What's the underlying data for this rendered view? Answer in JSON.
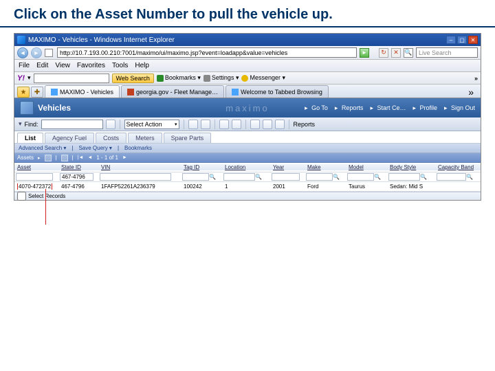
{
  "slide": {
    "title": "Click on the Asset Number to pull the vehicle up."
  },
  "ie": {
    "title": "MAXIMO - Vehicles - Windows Internet Explorer",
    "url": "http://10.7.193.00.210:7001/maximo/ui/maximo.jsp?event=loadapp&value=vehicles",
    "search_placeholder": "Live Search",
    "menus": [
      "File",
      "Edit",
      "View",
      "Favorites",
      "Tools",
      "Help"
    ],
    "yahoo": {
      "brand": "Y!",
      "search_btn": "Web Search",
      "links": [
        {
          "label": "Bookmarks ▾",
          "color": "#2a8a2a"
        },
        {
          "label": "Settings ▾",
          "color": "#888"
        },
        {
          "label": "Messenger ▾",
          "color": "#e6b800"
        }
      ],
      "more": "»"
    },
    "tabs": [
      {
        "label": "MAXIMO - Vehicles",
        "active": true,
        "icon": "#4aa3ff"
      },
      {
        "label": "georgia.gov - Fleet Manage…",
        "active": false,
        "icon": "#c04020"
      },
      {
        "label": "Welcome to Tabbed Browsing",
        "active": false,
        "icon": "#4aa3ff"
      }
    ],
    "chevron": "»"
  },
  "maximo": {
    "logo": "maximo",
    "module": "Vehicles",
    "nav": [
      {
        "label": "Go To",
        "icon": "#e0e0e0"
      },
      {
        "label": "Reports",
        "icon": "#e0e0e0"
      },
      {
        "label": "Start Ce…",
        "icon": "#e0e0e0"
      },
      {
        "label": "Profile",
        "icon": "#e0e0e0"
      },
      {
        "label": "Sign Out",
        "icon": "#e0e0e0"
      }
    ],
    "find_label": "Find:",
    "action_select": "Select Action",
    "reports_btn": "Reports",
    "subtabs": [
      "List",
      "Agency Fuel",
      "Costs",
      "Meters",
      "Spare Parts"
    ],
    "active_subtab": 0,
    "advlinks": [
      "Advanced Search ▾",
      "Save Query ▾",
      "Bookmarks"
    ],
    "assets_bar": {
      "title": "Assets",
      "pager": "1 - 1 of 1"
    },
    "columns": [
      "Asset",
      "State ID",
      "VIN",
      "Tag ID",
      "Location",
      "Year",
      "Make",
      "Model",
      "Body Style",
      "Capacity Band"
    ],
    "filters": {
      "state_id": "467-4796"
    },
    "rows": [
      {
        "asset": "4070-472372",
        "state_id": "467-4796",
        "vin": "1FAFP52261A236379",
        "tag": "100242",
        "location": "1",
        "year": "2001",
        "make": "Ford",
        "model": "Taurus",
        "body": "Sedan: Mid S",
        "cap": ""
      }
    ],
    "select_records": "Select Records"
  }
}
